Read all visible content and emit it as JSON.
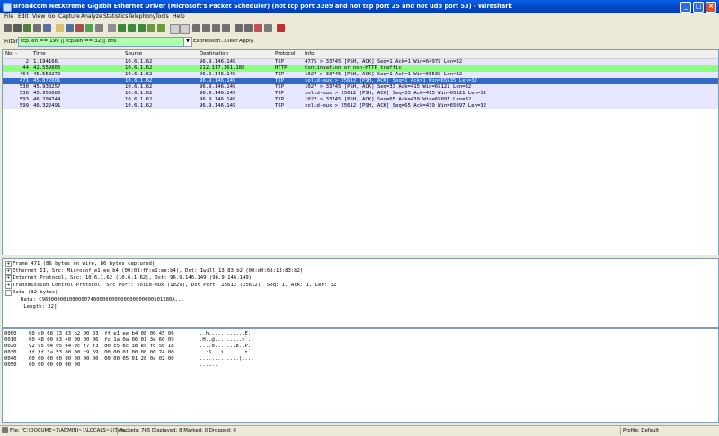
{
  "window": {
    "title": "Broadcom NetXtreme Gigabit Ethernet Driver (Microsoft's Packet Scheduler)  (not tcp port 3389 and not tcp port 25 and not udp port 53) - Wireshark",
    "minimize": "_",
    "maximize": "□",
    "close": "×"
  },
  "menu": [
    "File",
    "Edit",
    "View",
    "Go",
    "Capture",
    "Analyze",
    "Statistics",
    "Telephony",
    "Tools",
    "Help"
  ],
  "toolbar_icons": [
    "interfaces-icon",
    "options-icon",
    "start-icon",
    "stop-icon",
    "restart-icon",
    "open-icon",
    "save-icon",
    "close-file-icon",
    "reload-icon",
    "print-icon",
    "find-icon",
    "back-icon",
    "forward-icon",
    "goto-icon",
    "first-icon",
    "last-icon",
    "colorize-icon",
    "autoscroll-icon",
    "zoom-in-icon",
    "zoom-out-icon",
    "normal-size-icon",
    "resize-columns-icon",
    "capture-filters-icon",
    "display-filters-icon",
    "coloring-rules-icon",
    "preferences-icon",
    "help-icon"
  ],
  "filter": {
    "label": "Filter:",
    "value": "tcp.len == 199 || tcp.len == 32 || dns",
    "expression": "Expression...",
    "clear": "Clear",
    "apply": "Apply",
    "bg_color": "#afffaf"
  },
  "packet_list": {
    "columns": [
      "No. -",
      "Time",
      "Source",
      "Destination",
      "Protocol",
      "Info"
    ],
    "rows": [
      {
        "no": "2",
        "time": "1.194166",
        "src": "10.6.1.62",
        "dst": "96.9.146.149",
        "proto": "TCP",
        "info": "4775 > 33745 [PSH, ACK] Seq=1 Ack=1 Win=64975 Len=32",
        "bg": "#e7e6ff",
        "fg": "#000000"
      },
      {
        "no": "44",
        "time": "42.559805",
        "src": "10.6.1.62",
        "dst": "212.117.161.188",
        "proto": "HTTP",
        "info": "Continuation or non-HTTP traffic",
        "bg": "#8dff7f",
        "fg": "#000000"
      },
      {
        "no": "464",
        "time": "45.558272",
        "src": "10.6.1.62",
        "dst": "96.9.146.149",
        "proto": "TCP",
        "info": "1027 > 33745 [PSH, ACK] Seq=1 Ack=1 Win=65535 Len=32",
        "bg": "#e7e6ff",
        "fg": "#000000"
      },
      {
        "no": "471",
        "time": "45.672001",
        "src": "10.6.1.62",
        "dst": "96.9.146.149",
        "proto": "TCP",
        "info": "solid-mux > 25612 [PSH, ACK] Seq=1 Ack=1 Win=65535 Len=32",
        "bg": "#316ac5",
        "fg": "#ffffff"
      },
      {
        "no": "530",
        "time": "45.938257",
        "src": "10.6.1.62",
        "dst": "96.9.146.149",
        "proto": "TCP",
        "info": "1027 > 33745 [PSH, ACK] Seq=33 Ack=415 Win=65121 Len=32",
        "bg": "#e7e6ff",
        "fg": "#000000"
      },
      {
        "no": "536",
        "time": "45.958686",
        "src": "10.6.1.62",
        "dst": "96.9.146.149",
        "proto": "TCP",
        "info": "solid-mux > 25612 [PSH, ACK] Seq=33 Ack=415 Win=65121 Len=32",
        "bg": "#e7e6ff",
        "fg": "#000000"
      },
      {
        "no": "593",
        "time": "46.294744",
        "src": "10.6.1.62",
        "dst": "96.9.146.149",
        "proto": "TCP",
        "info": "1027 > 33745 [PSH, ACK] Seq=65 Ack=439 Win=65097 Len=32",
        "bg": "#e7e6ff",
        "fg": "#000000"
      },
      {
        "no": "599",
        "time": "46.322491",
        "src": "10.6.1.62",
        "dst": "96.9.146.149",
        "proto": "TCP",
        "info": "solid-mux > 25612 [PSH, ACK] Seq=65 Ack=439 Win=65097 Len=32",
        "bg": "#e7e6ff",
        "fg": "#000000"
      }
    ]
  },
  "details": [
    {
      "expander": "+",
      "text": "Frame 471 (86 bytes on wire, 86 bytes captured)"
    },
    {
      "expander": "+",
      "text": "Ethernet II, Src: Microsof_e1:ee:b4 (00:03:ff:e1:ee:b4), Dst: Iwill_13:83:b2 (00:d0:68:13:83:b2)"
    },
    {
      "expander": "+",
      "text": "Internet Protocol, Src: 10.6.1.62 (10.6.1.62), Dst: 96.9.146.149 (96.9.146.149)"
    },
    {
      "expander": "+",
      "text": "Transmission Control Protocol, Src Port: solid-mux (1029), Dst Port: 25612 (25612), Seq: 1, Ack: 1, Len: 32"
    },
    {
      "expander": "-",
      "text": "Data (32 bytes)"
    },
    {
      "expander": "",
      "text": "Data: C9690000010000007400000000000000000000501280A..."
    },
    {
      "expander": "",
      "text": "[Length: 32]"
    }
  ],
  "hex": [
    {
      "off": "0000",
      "hex": "00 d0 68 13 83 b2 00 03  ff e1 ee b4 08 00 45 00",
      "asc": "..h..... ......E."
    },
    {
      "off": "0010",
      "hex": "00 48 00 b3 40 00 80 06  fc 1a 0a 06 01 3e 60 09",
      "asc": ".H..@... .....>`."
    },
    {
      "off": "0020",
      "hex": "92 95 04 05 64 0c f7 f3  d0 c5 ec 38 ec fd 50 18",
      "asc": "....d... ...8..P."
    },
    {
      "off": "0030",
      "hex": "ff ff 3a 53 00 00 c9 69  00 00 01 00 00 00 74 00",
      "asc": "..:S...i ......t."
    },
    {
      "off": "0040",
      "hex": "00 00 00 00 00 00 00 00  00 00 05 01 28 0a 02 00",
      "asc": "........ ....(...."
    },
    {
      "off": "0050",
      "hex": "00 00 00 00 00 00",
      "asc": "......"
    }
  ],
  "status": {
    "file": "File: \"C:\\DOCUME~1\\ADMINI~1\\LOCALS~1\\Tem...",
    "packets": "Packets: 765 Displayed: 8 Marked: 0 Dropped: 0",
    "profile": "Profile: Default"
  }
}
